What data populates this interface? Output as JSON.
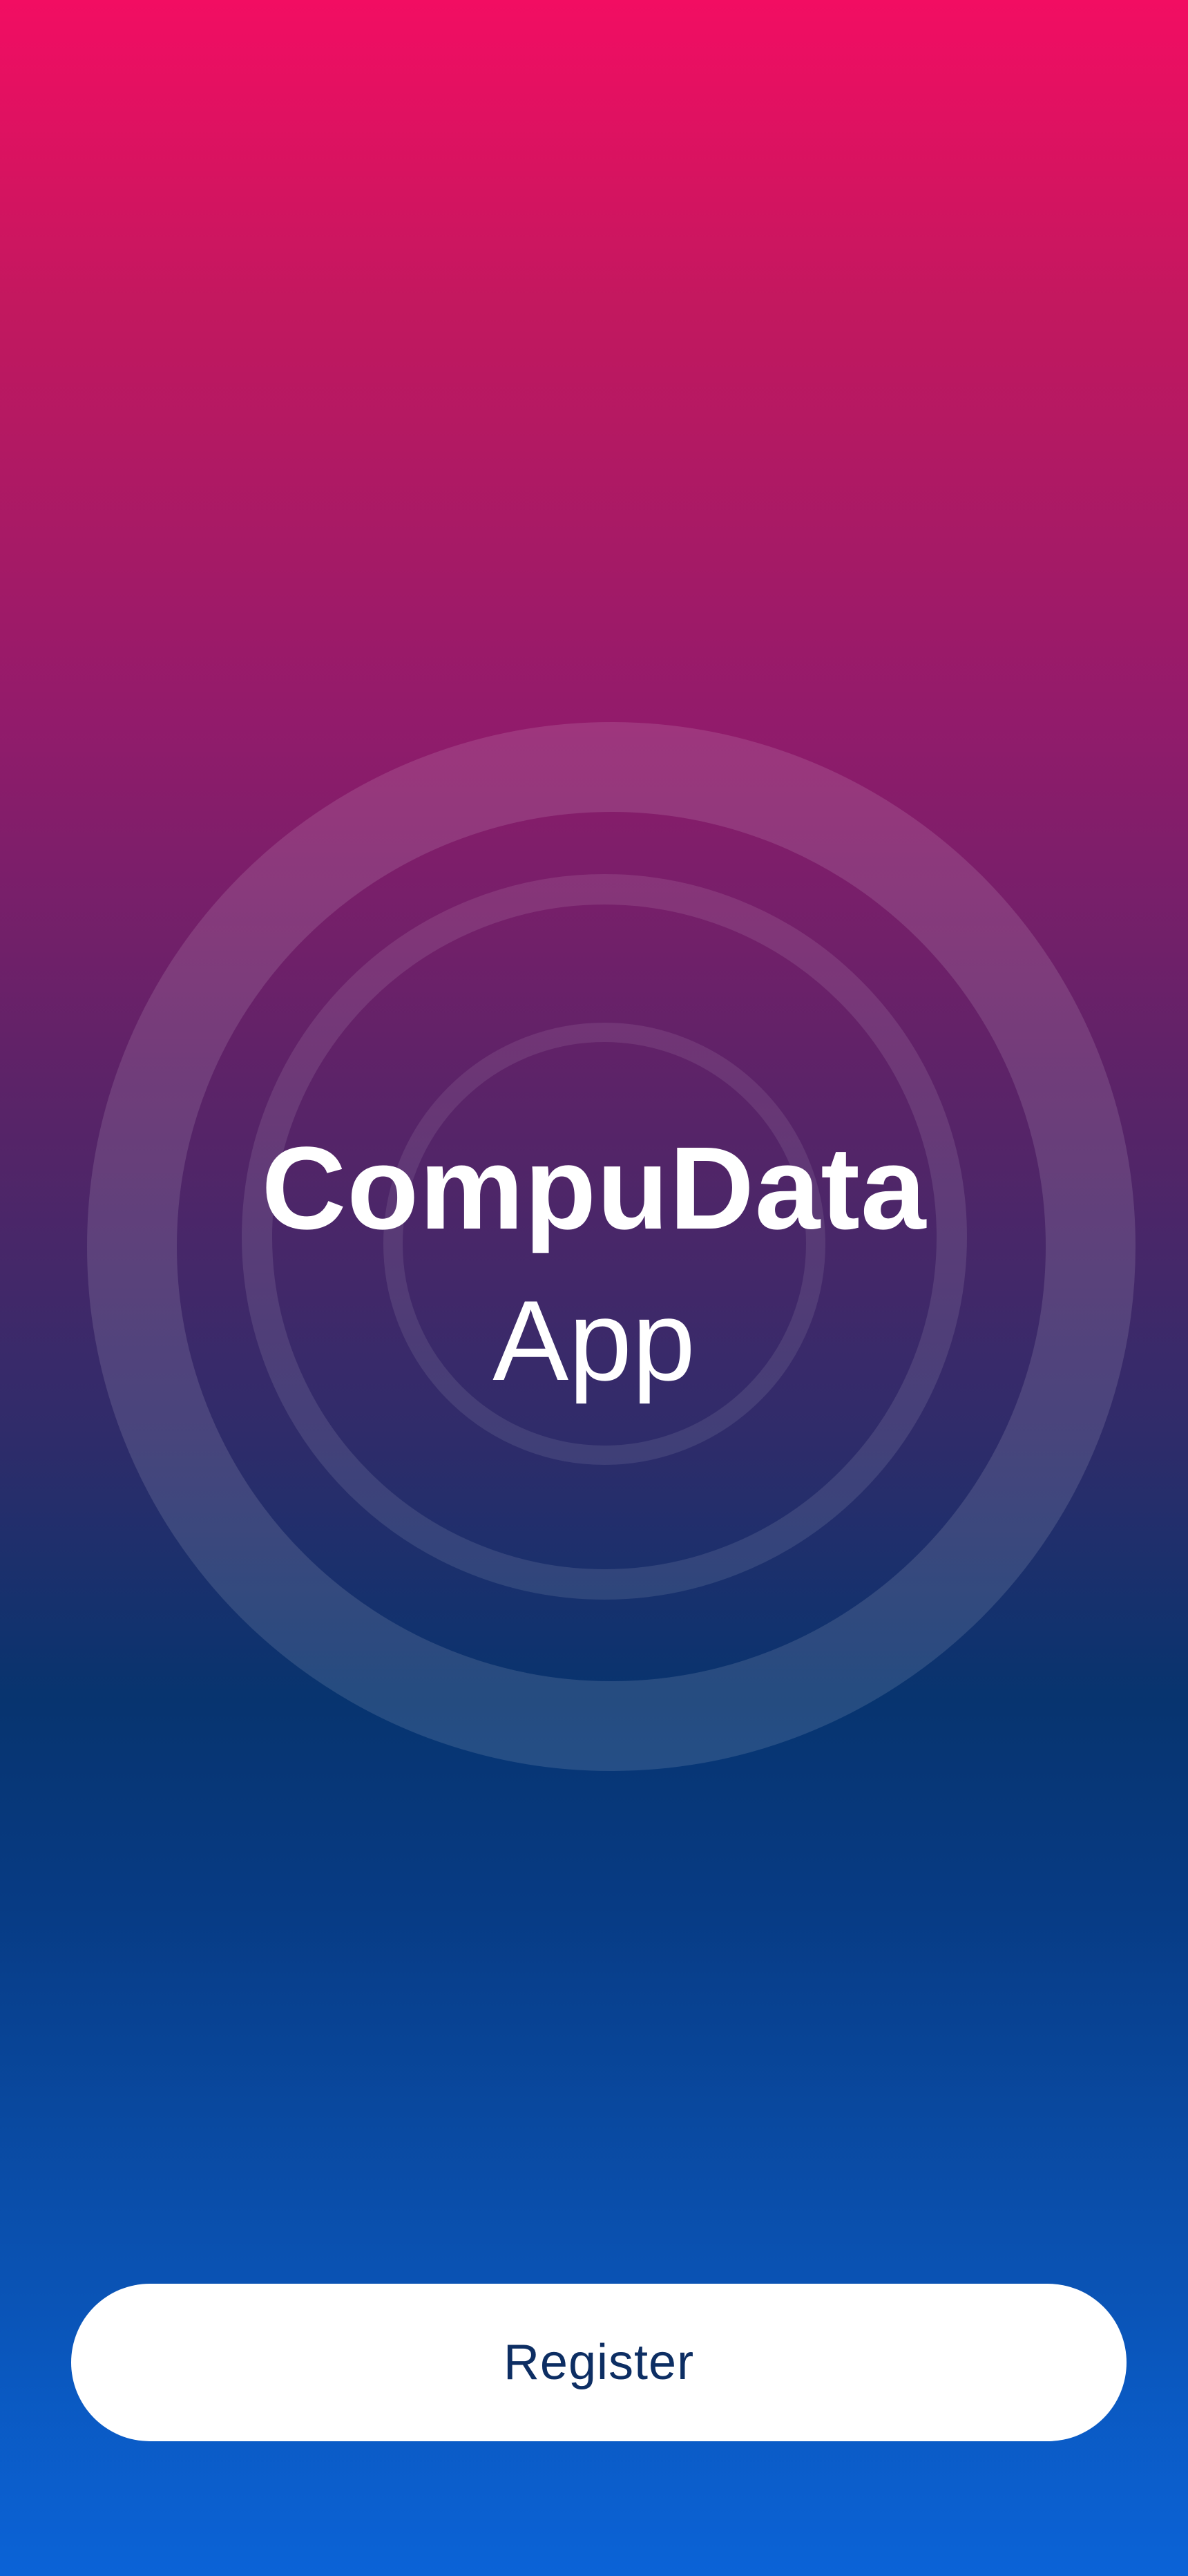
{
  "app": {
    "title": "CompuData",
    "subtitle": "App"
  },
  "actions": {
    "register_label": "Register"
  },
  "colors": {
    "gradient_top": "#f20d62",
    "gradient_mid": "#07346f",
    "gradient_bottom": "#0b63d7",
    "button_background": "#ffffff",
    "button_text": "#0d2e63"
  }
}
